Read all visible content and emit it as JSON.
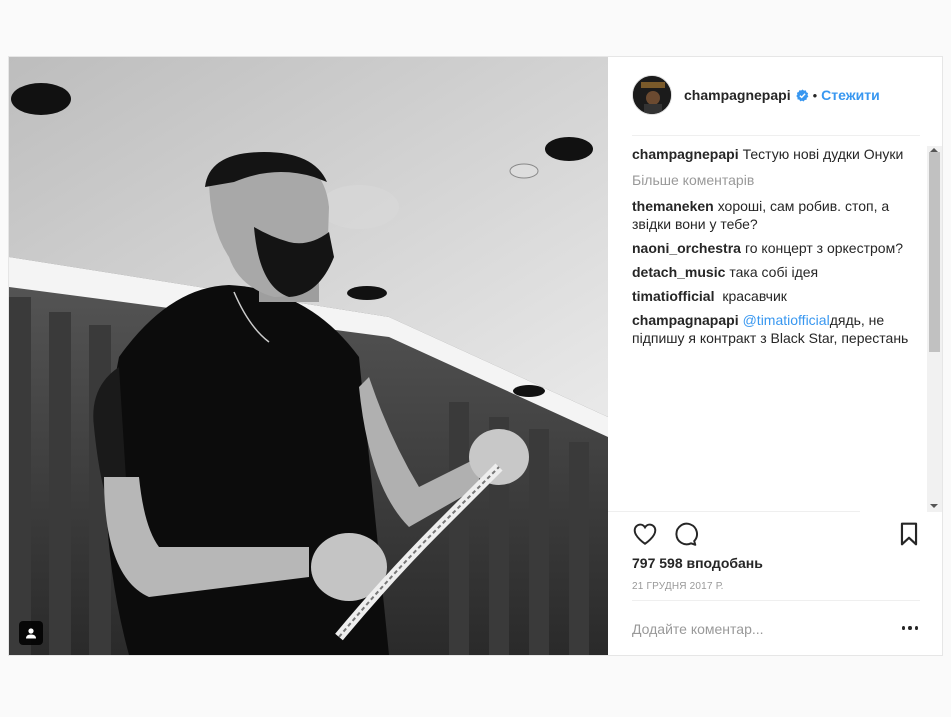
{
  "post": {
    "username": "champagnepapi",
    "separator": "•",
    "follow_label": "Стежити",
    "caption": {
      "user": "champagnepapi",
      "text": "Тестую нові дудки Онуки"
    },
    "load_more_label": "Більше коментарів",
    "comments": [
      {
        "user": "themaneken",
        "text": "хороші, сам робив. стоп, а звідки вони у тебе?"
      },
      {
        "user": "naoni_orchestra",
        "text": "го концерт з оркестром?"
      },
      {
        "user": "detach_music",
        "text": "така собі ідея"
      },
      {
        "user": "timatiofficial",
        "text": " красавчик"
      },
      {
        "user": "champagnapapi",
        "mention": "@timatiofficial",
        "text": "дядь, не підпишу я контракт з Black Star, перестань"
      }
    ],
    "likes": "797 598 вподобань",
    "date": "21 ГРУДНЯ 2017 Р.",
    "comment_placeholder": "Додайте коментар..."
  },
  "icons": {
    "heart": "heart-icon",
    "comment": "comment-icon",
    "save": "bookmark-icon",
    "more": "more-options-icon",
    "verified": "verified-badge-icon",
    "tag": "user-tag-icon"
  },
  "colors": {
    "link": "#3897f0",
    "text": "#262626",
    "muted": "#999999",
    "border": "#efefef"
  }
}
